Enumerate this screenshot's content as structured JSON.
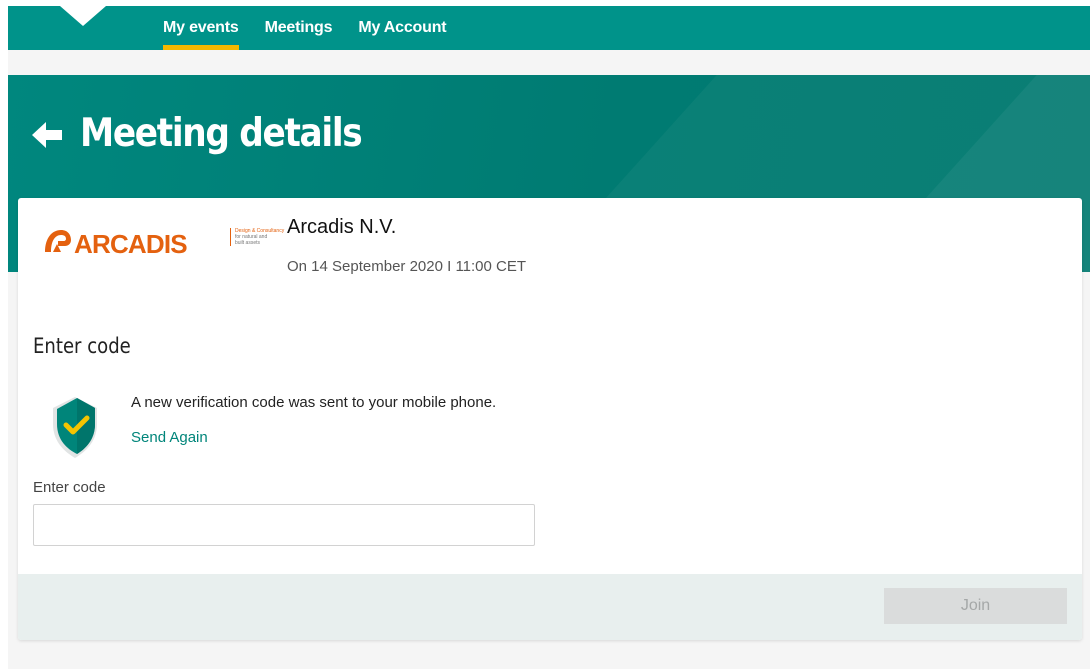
{
  "nav": {
    "items": [
      {
        "label": "My events",
        "active": true
      },
      {
        "label": "Meetings",
        "active": false
      },
      {
        "label": "My Account",
        "active": false
      }
    ],
    "accent_color": "#f5b800",
    "bar_color": "#00938a"
  },
  "header": {
    "title": "Meeting details",
    "back_icon": "arrow-left-icon"
  },
  "meeting": {
    "logo": {
      "brand": "ARCADIS",
      "tagline_line1": "Design & Consultancy",
      "tagline_line2": "for natural and",
      "tagline_line3": "built assets",
      "color": "#e4610f"
    },
    "company": "Arcadis N.V.",
    "date": "On 14 September 2020 I 11:00 CET"
  },
  "verification": {
    "section_title": "Enter code",
    "icon": "shield-check-icon",
    "message": "A new verification code was sent to your mobile phone.",
    "send_again": "Send Again",
    "field_label": "Enter code",
    "code_value": "",
    "placeholder": ""
  },
  "footer": {
    "join_label": "Join",
    "join_enabled": false
  }
}
